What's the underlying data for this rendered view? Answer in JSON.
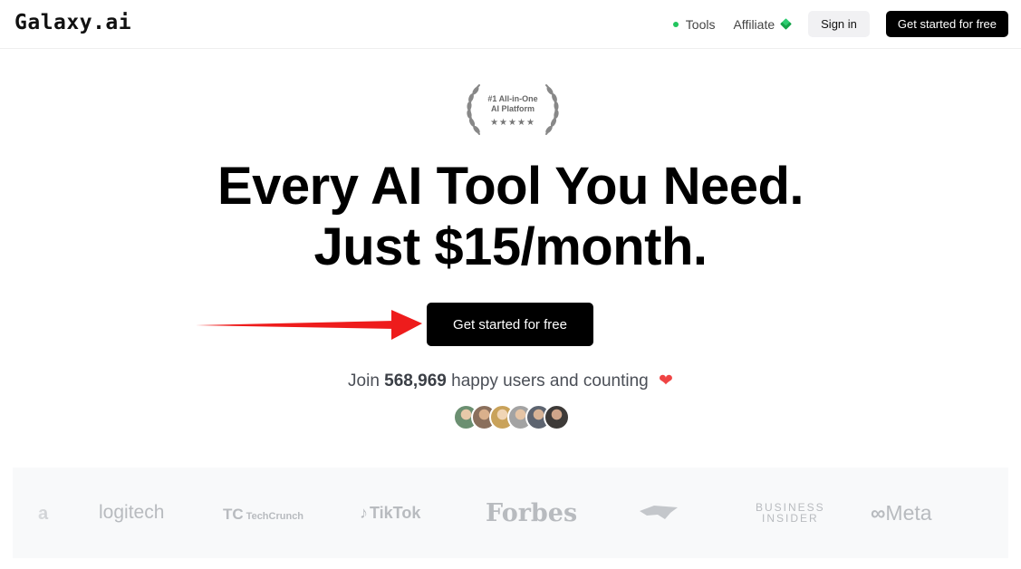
{
  "header": {
    "logo": "Galaxy.ai",
    "nav": {
      "tools_label": "Tools",
      "affiliate_label": "Affiliate",
      "signin_label": "Sign in",
      "cta_label": "Get started for free"
    }
  },
  "badge": {
    "line1": "#1 All-in-One",
    "line2": "AI Platform",
    "stars": "★★★★★"
  },
  "hero": {
    "headline_line1": "Every AI Tool You Need.",
    "headline_line2": "Just $15/month.",
    "cta_label": "Get started for free"
  },
  "social_proof": {
    "prefix": "Join",
    "count": "568,969",
    "suffix": "happy users and counting",
    "heart": "❤"
  },
  "avatar_colors": [
    "#6b8f71",
    "#8a6f5c",
    "#c9a25a",
    "#a3a3a3",
    "#5d6470",
    "#3d3a38"
  ],
  "press_logos": [
    "a",
    "logitech",
    "TechCrunch",
    "TikTok",
    "Forbes",
    "BUSINESS",
    "INSIDER",
    "Meta"
  ],
  "colors": {
    "accent_green": "#22c55e",
    "arrow_red": "#ee1c1c",
    "heart_red": "#ef4444"
  }
}
